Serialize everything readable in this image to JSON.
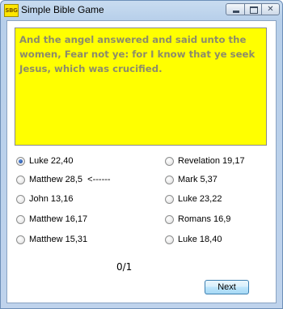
{
  "window": {
    "icon_text": "SBG",
    "title": "Simple Bible Game"
  },
  "verse": {
    "text": "And the angel answered and said unto the women, Fear not ye: for I know that ye seek Jesus, which was crucified."
  },
  "options_left": [
    {
      "label": "Luke 22,40",
      "checked": true
    },
    {
      "label": "Matthew 28,5  <------",
      "checked": false
    },
    {
      "label": "John 13,16",
      "checked": false
    },
    {
      "label": "Matthew 16,17",
      "checked": false
    },
    {
      "label": "Matthew 15,31",
      "checked": false
    }
  ],
  "options_right": [
    {
      "label": "Revelation 19,17",
      "checked": false
    },
    {
      "label": "Mark 5,37",
      "checked": false
    },
    {
      "label": "Luke 23,22",
      "checked": false
    },
    {
      "label": "Romans 16,9",
      "checked": false
    },
    {
      "label": "Luke 18,40",
      "checked": false
    }
  ],
  "score": "0/1",
  "next_label": "Next",
  "colors": {
    "verse_background": "#ffff00",
    "verse_text": "#8c8c6a"
  }
}
